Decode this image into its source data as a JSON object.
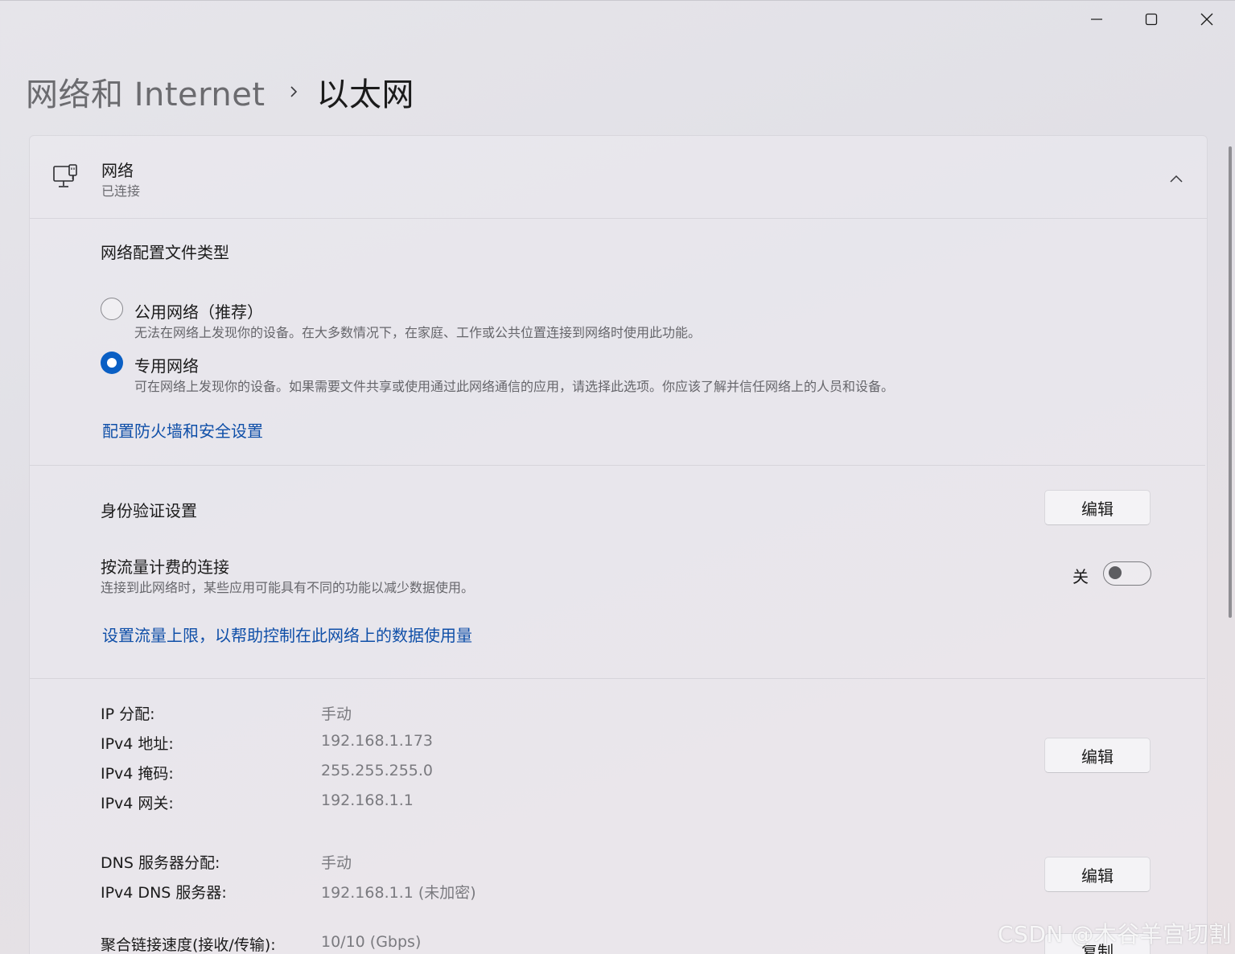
{
  "window": {
    "minimize": "minimize",
    "maximize": "maximize",
    "close": "close"
  },
  "breadcrumb": {
    "parent": "网络和 Internet",
    "current": "以太网"
  },
  "network_card": {
    "title": "网络",
    "status": "已连接"
  },
  "profile": {
    "heading": "网络配置文件类型",
    "options": [
      {
        "label": "公用网络（推荐）",
        "description": "无法在网络上发现你的设备。在大多数情况下，在家庭、工作或公共位置连接到网络时使用此功能。",
        "selected": false
      },
      {
        "label": "专用网络",
        "description": "可在网络上发现你的设备。如果需要文件共享或使用通过此网络通信的应用，请选择此选项。你应该了解并信任网络上的人员和设备。",
        "selected": true
      }
    ],
    "firewall_link": "配置防火墙和安全设置"
  },
  "auth": {
    "label": "身份验证设置",
    "edit_label": "编辑"
  },
  "metered": {
    "label": "按流量计费的连接",
    "description": "连接到此网络时，某些应用可能具有不同的功能以减少数据使用。",
    "toggle_state": "关",
    "toggle_on": false,
    "data_limit_link": "设置流量上限，以帮助控制在此网络上的数据使用量"
  },
  "ip": {
    "rows": [
      {
        "key": "IP 分配:",
        "value": "手动"
      },
      {
        "key": "IPv4 地址:",
        "value": "192.168.1.173"
      },
      {
        "key": "IPv4 掩码:",
        "value": "255.255.255.0"
      },
      {
        "key": "IPv4 网关:",
        "value": "192.168.1.1"
      }
    ],
    "edit_label": "编辑"
  },
  "dns": {
    "rows": [
      {
        "key": "DNS 服务器分配:",
        "value": "手动"
      },
      {
        "key": "IPv4 DNS 服务器:",
        "value": "192.168.1.1 (未加密)"
      }
    ],
    "edit_label": "编辑"
  },
  "link_speed": {
    "key": "聚合链接速度(接收/传输):",
    "value": "10/10 (Gbps)",
    "copy_label": "复制"
  },
  "watermark": "CSDN @木谷羊宫切割",
  "colors": {
    "accent": "#0a5fc4",
    "link": "#0f4fa8"
  }
}
